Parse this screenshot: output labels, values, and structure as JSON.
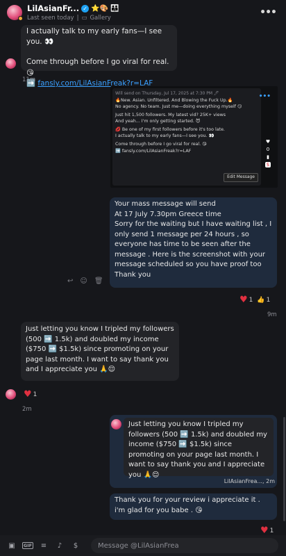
{
  "header": {
    "name": "LilAsianFr...",
    "emojis": "⭐🎨 👪",
    "status": "Last seen today",
    "gallery_label": "Gallery",
    "more": "•••"
  },
  "msg1": {
    "line1": "I actually talk to my early fans—I see you. 👀",
    "line2": "Come through before I go viral for real. 😘",
    "link": "fansly.com/LilAsianFreak?r=LAF",
    "link_prefix": "➡️",
    "time": "11m"
  },
  "screenshot": {
    "send_on": "Will send on Thursday, Jul 17, 2025 at 7:30 PM 🖊",
    "p1": "🔥New. Asian. Unfiltered. And Blowing the Fuck Up.🔥",
    "p2": "No agency. No team. Just me—doing everything myself 😏",
    "p3": "Just hit 1,500 followers. My latest vid? 25K+ views",
    "p4": "And yeah... I'm only getting started. 😈",
    "p5": "💋 Be one of my first followers before it's too late.",
    "p6": "I actually talk to my early fans—I see you. 👀",
    "p7": "Come through before I go viral for real. 😘",
    "p8": "➡️ fansly.com/LilAsianFreak?r=LAF",
    "edit": "Edit Message",
    "likes": "0"
  },
  "msg2": {
    "text": "Your mass message will send\nAt  17 July 7.30pm Greece time\nSorry for the waiting but I have waiting list , I only send 1 message per 24 hours , so everyone has time to be seen after the message . Here is the screenshot with your message scheduled so you have proof too\nThank you",
    "react_count": "1",
    "time": "9m"
  },
  "msg3": {
    "text": "Just letting you know I tripled my followers (500 ➡️ 1.5k) and doubled my income ($750 ➡️ $1.5k) since promoting on your page last month. I want to say thank you and I appreciate you 🙏😌",
    "react_count": "1",
    "time": "2m"
  },
  "msg4": {
    "quote": "Just letting you know I tripled my followers (500 ➡️ 1.5k) and doubled my income ($750 ➡️ $1.5k) since promoting on your page last month. I want to say thank you and I appreciate you 🙏😌",
    "sender": "LilAsianFrea..., 2m",
    "reply": "Thank you for your review i appreciate it . i'm glad for you babe . 😘",
    "react_count": "1"
  },
  "composer": {
    "placeholder": "Message @LilAsianFrea",
    "gif": "GIF",
    "dollar": "$"
  }
}
